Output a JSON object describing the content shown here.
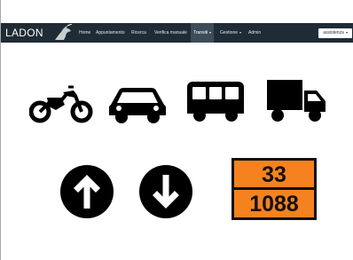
{
  "app": {
    "brand": "LADON"
  },
  "nav": {
    "items": [
      {
        "label": "Home"
      },
      {
        "label": "Appuntamento"
      },
      {
        "label": "Ricerca"
      },
      {
        "label": "Verifica manuale"
      },
      {
        "label": "Transiti"
      },
      {
        "label": "Gestione"
      },
      {
        "label": "Admin"
      }
    ],
    "active": "Transiti",
    "user_menu": "assistenza"
  },
  "vehicles": [
    "motorcycle-icon",
    "car-icon",
    "bus-icon",
    "truck-icon"
  ],
  "directions": [
    "arrow-up-icon",
    "arrow-down-icon"
  ],
  "hazard_plate": {
    "hazard_id": "33",
    "un_number": "1088"
  },
  "colors": {
    "navbar": "#1f2b35",
    "plate": "#f5821f",
    "icon": "#000000"
  }
}
